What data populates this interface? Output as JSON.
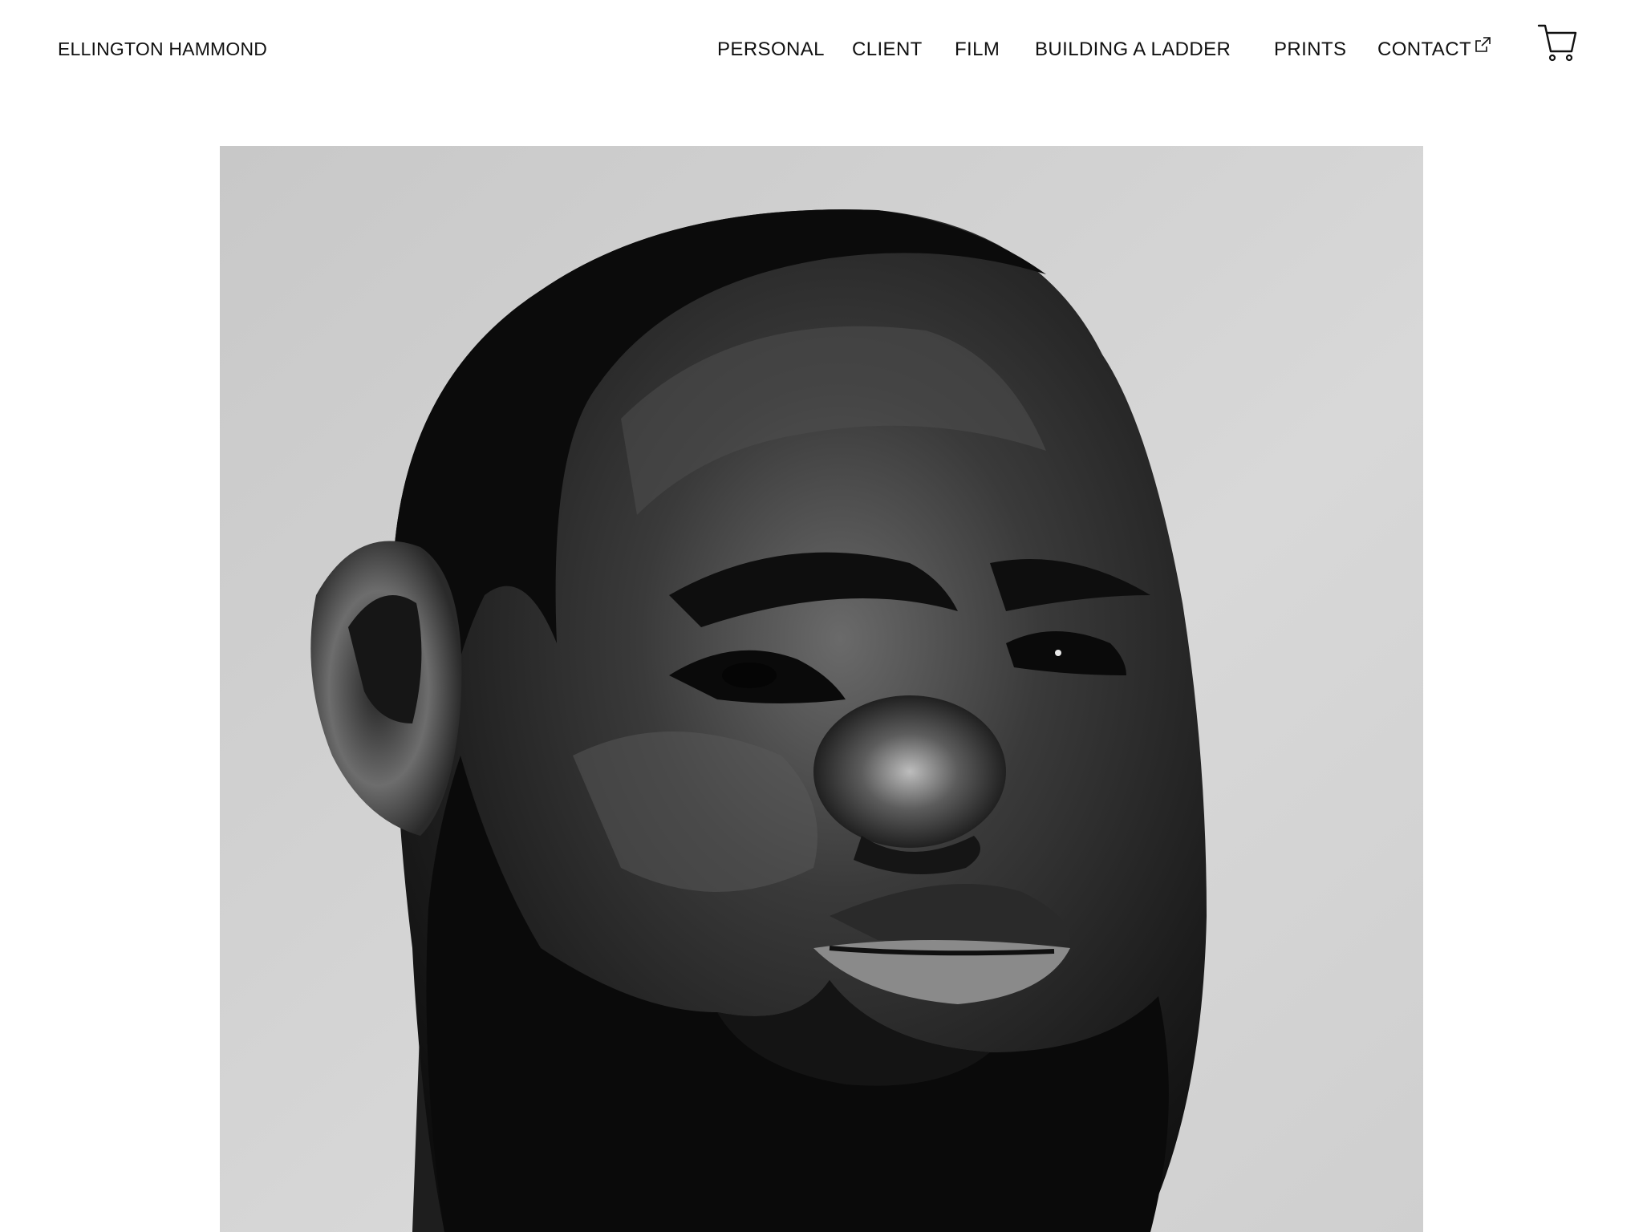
{
  "header": {
    "brand": "ELLINGTON HAMMOND",
    "nav": {
      "personal": "PERSONAL",
      "client": "CLIENT",
      "film": "FILM",
      "building": "BUILDING A LADDER",
      "prints": "PRINTS",
      "contact": "CONTACT"
    },
    "contact_icon": "external-link-icon",
    "cart_icon": "cart-icon"
  },
  "hero": {
    "style": "black-and-white portrait photograph"
  },
  "colors": {
    "text": "#111111",
    "background": "#ffffff"
  }
}
